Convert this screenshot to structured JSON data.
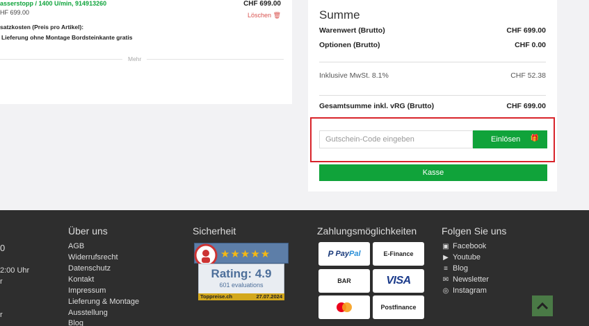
{
  "cart_item": {
    "title": "asserstopp / 1400 U/min, 914913260",
    "unit_price": "HF 699.00",
    "price": "CHF 699.00",
    "delete_label": "Löschen",
    "extra_costs_label": "satzkosten (Preis pro Artikel):",
    "extra_costs_value": "Lieferung ohne Montage Bordsteinkante gratis",
    "more_label": "Mehr"
  },
  "summary": {
    "title": "Summe",
    "rows": [
      {
        "label": "Warenwert (Brutto)",
        "value": "CHF 699.00"
      },
      {
        "label": "Optionen (Brutto)",
        "value": "CHF 0.00"
      },
      {
        "label": "Inklusive MwSt. 8.1%",
        "value": "CHF 52.38"
      },
      {
        "label": "Gesamtsumme inkl. vRG (Brutto)",
        "value": "CHF 699.00"
      }
    ],
    "voucher_placeholder": "Gutschein-Code eingeben",
    "redeem_label": "Einlösen",
    "checkout_label": "Kasse"
  },
  "footer": {
    "left_fragments": [
      "0",
      "2:00 Uhr",
      "r",
      "r"
    ],
    "about": {
      "heading": "Über uns",
      "links": [
        "AGB",
        "Widerrufsrecht",
        "Datenschutz",
        "Kontakt",
        "Impressum",
        "Lieferung & Montage",
        "Ausstellung",
        "Blog"
      ]
    },
    "security": {
      "heading": "Sicherheit",
      "badge_rating": "Rating: 4.9",
      "badge_evaluations": "601 evaluations",
      "badge_site": "Toppreise.ch",
      "badge_date": "27.07.2024"
    },
    "payment": {
      "heading": "Zahlungsmöglichkeiten",
      "paypal_a": "Pay",
      "paypal_b": "Pal",
      "efinance": "E-Finance",
      "bar": "BAR",
      "visa": "VISA",
      "postfinance": "Postfinance"
    },
    "social": {
      "heading": "Folgen Sie uns",
      "links": [
        "Facebook",
        "Youtube",
        "Blog",
        "Newsletter",
        "Instagram"
      ]
    }
  },
  "colors": {
    "accent_green": "#10a33a",
    "highlight_red": "#d8232a",
    "footer_bg": "#2e2e2e"
  }
}
